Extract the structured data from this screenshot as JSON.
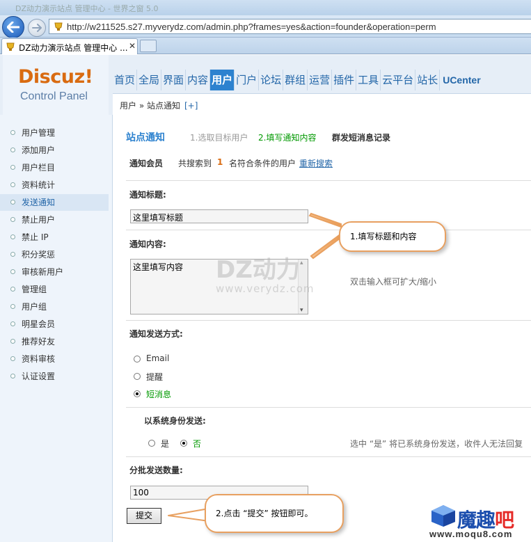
{
  "browser": {
    "window_title": "DZ动力演示站点 管理中心 - 世界之窗 5.0",
    "url": "http://w211525.s27.myverydz.com/admin.php?frames=yes&action=founder&operation=perm",
    "tab_title": "DZ动力演示站点 管理中心 ...",
    "tab_close": "✕"
  },
  "header": {
    "logo_main": "Discuz!",
    "logo_sub": "Control Panel",
    "nav": [
      "首页",
      "全局",
      "界面",
      "内容",
      "用户",
      "门户",
      "论坛",
      "群组",
      "运营",
      "插件",
      "工具",
      "云平台",
      "站长",
      "UCenter"
    ],
    "active_nav": "用户",
    "breadcrumb": "用户 » 站点通知",
    "breadcrumb_plus": "[+]"
  },
  "sidebar": {
    "items": [
      "用户管理",
      "添加用户",
      "用户栏目",
      "资料统计",
      "发送通知",
      "禁止用户",
      "禁止 IP",
      "积分奖惩",
      "审核新用户",
      "管理组",
      "用户组",
      "明星会员",
      "推荐好友",
      "资料审核",
      "认证设置"
    ],
    "active": "发送通知"
  },
  "main": {
    "page_title": "站点通知",
    "step1": "1.选取目标用户",
    "step2": "2.填写通知内容",
    "step3": "群发短消息记录",
    "members_label": "通知会员",
    "members_text_a": "共搜索到",
    "members_count": "1",
    "members_text_b": "名符合条件的用户",
    "research_link": "重新搜索",
    "title_label": "通知标题:",
    "title_value": "这里填写标题",
    "content_label": "通知内容:",
    "content_value": "这里填写内容",
    "content_hint": "双击输入框可扩大/缩小",
    "method_label": "通知发送方式:",
    "methods": [
      "Email",
      "提醒",
      "短消息"
    ],
    "method_selected": "短消息",
    "system_label": "以系统身份发送:",
    "system_yes": "是",
    "system_no": "否",
    "system_selected": "否",
    "system_hint": "选中 “是” 将已系统身份发送，收件人无法回复",
    "batch_label": "分批发送数量:",
    "batch_value": "100",
    "submit_label": "提交"
  },
  "annotations": {
    "callout1": "1.填写标题和内容",
    "callout2": "2.点击 “提交” 按钮即可。"
  },
  "watermark": {
    "main": "DZ动力",
    "sub": "www.verydz.com"
  },
  "corner_logo": {
    "main_blue": "魔趣",
    "main_red": "吧",
    "url": "www.moqu8.com"
  },
  "colors": {
    "accent": "#2d82cf",
    "logo_orange": "#d96b11",
    "callout_border": "#e8a060",
    "step_active": "#009900"
  }
}
